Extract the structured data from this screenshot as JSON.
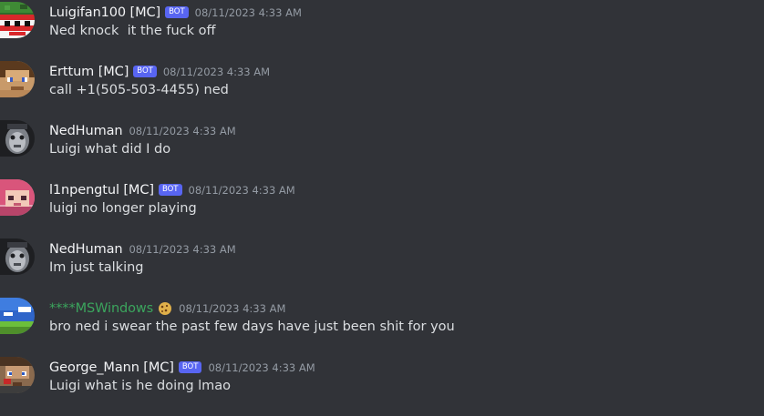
{
  "bot_tag": "BOT",
  "colors": {
    "background": "#313338",
    "username": "#f2f3f5",
    "username_green": "#3ba55d",
    "bot_tag": "#5865f2",
    "timestamp": "#949ba4",
    "message_text": "#dbdee1"
  },
  "messages": [
    {
      "username": "Luigifan100 [MC]",
      "bot": true,
      "timestamp": "08/11/2023 4:33 AM",
      "content": "Ned knock  it the fuck off",
      "avatar_icon": "pixel-avatar-icon"
    },
    {
      "username": "Erttum [MC]",
      "bot": true,
      "timestamp": "08/11/2023 4:33 AM",
      "content": "call +1(505-503-4455) ned",
      "avatar_icon": "pixel-avatar-icon"
    },
    {
      "username": "NedHuman",
      "bot": false,
      "timestamp": "08/11/2023 4:33 AM",
      "content": "Luigi what did I do",
      "avatar_icon": "user-avatar-icon"
    },
    {
      "username": "l1npengtul [MC]",
      "bot": true,
      "timestamp": "08/11/2023 4:33 AM",
      "content": "luigi no longer playing",
      "avatar_icon": "pixel-avatar-icon"
    },
    {
      "username": "NedHuman",
      "bot": false,
      "timestamp": "08/11/2023 4:33 AM",
      "content": "Im just talking",
      "avatar_icon": "user-avatar-icon"
    },
    {
      "username": "****MSWindows",
      "bot": false,
      "timestamp": "08/11/2023 4:33 AM",
      "content": "bro ned i swear the past few days have just been shit for you",
      "avatar_icon": "landscape-avatar-icon",
      "role_icon": "cookie-icon"
    },
    {
      "username": "George_Mann [MC]",
      "bot": true,
      "timestamp": "08/11/2023 4:33 AM",
      "content": "Luigi what is he doing lmao",
      "avatar_icon": "pixel-avatar-icon"
    }
  ]
}
